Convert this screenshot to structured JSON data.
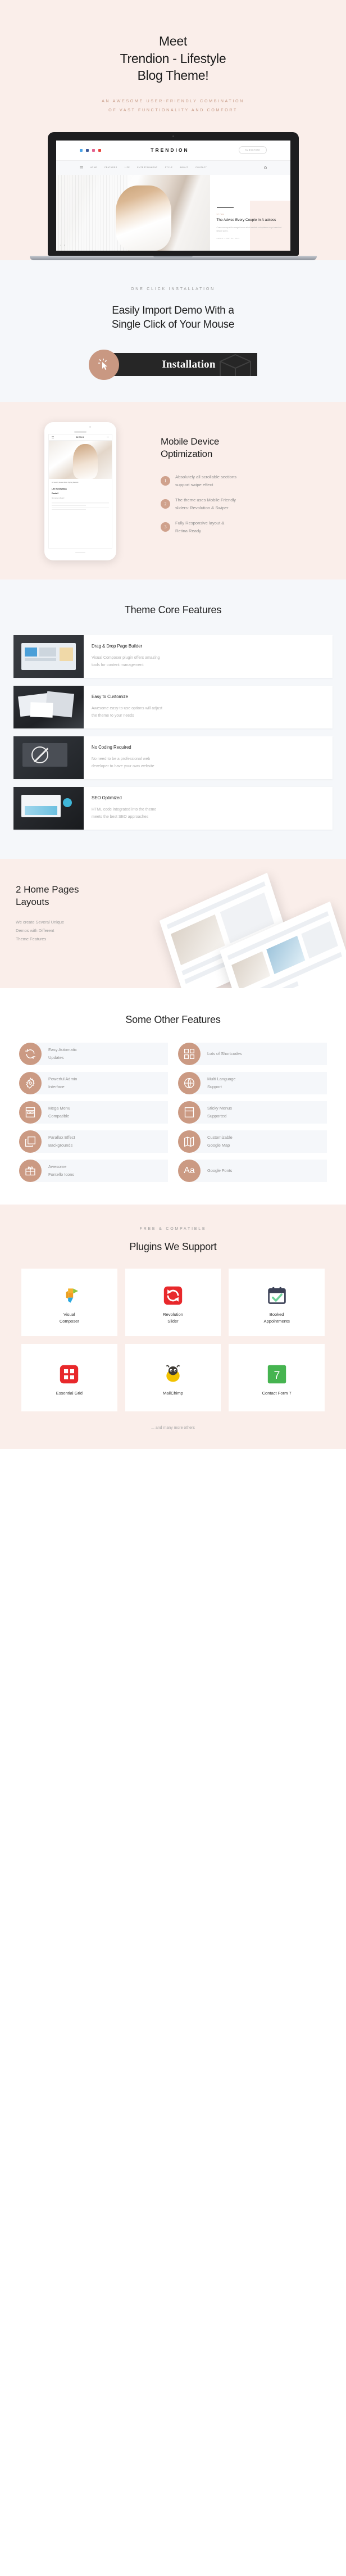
{
  "hero": {
    "title_line1": "Meet",
    "title_line2": "Trendion - Lifestyle",
    "title_line3": "Blog Theme!",
    "subtitle_line1": "AN AWESOME USER-FRIENDLY COMBINATION",
    "subtitle_line2": "OF VAST FUNCTIONALITY AND COMFORT",
    "mockup": {
      "logo": "TRENDION",
      "subscribe_button": "SUBSCRIBE",
      "nav": [
        "HOME",
        "FEATURES",
        "LIFE",
        "ENTERTAINMENT",
        "STYLE",
        "ABOUT",
        "CONTACT"
      ],
      "post_category": "STYLE",
      "post_title": "The Advice Every Couple In A ackess",
      "post_excerpt": "Cras consequat fur magni lorem sit sit rahtinis voluptatem sequi nesciunt. Neque porro.",
      "post_meta": "ADMIN   —   MAY 22, 2019"
    }
  },
  "install": {
    "eyebrow": "ONE CLICK INSTALLATION",
    "title_line1": "Easily Import Demo With a",
    "title_line2": "Single Click of Your Mouse",
    "badge_label": "Installation"
  },
  "mobile": {
    "title_line1": "Mobile Device",
    "title_line2": "Optimization",
    "items": [
      {
        "num": "1",
        "text_line1": "Absolutely all scrollable sections",
        "text_line2": "support swipe effect"
      },
      {
        "num": "2",
        "text_line1": "The theme uses Mobile Friendly",
        "text_line2": "sliders: Revolution & Swiper"
      },
      {
        "num": "3",
        "text_line1": "Fully Responsive layout &",
        "text_line2": "Retina Ready"
      }
    ],
    "phone": {
      "menu_label": "MENU",
      "logo": "TRENDION",
      "caption": "All Luxury House Floor Spring Defects",
      "post_title_line1": "Life Events Blog",
      "post_title_line2": "Posts 2",
      "post_sub": "My name is Ryan!"
    }
  },
  "core": {
    "title": "Theme Core Features",
    "cards": [
      {
        "title": "Drag & Drop Page Builder",
        "desc_line1": "Visual Composer plugin offers amazing",
        "desc_line2": "tools for content management"
      },
      {
        "title": "Easy to Customize",
        "desc_line1": "Awesome easy-to-use options will adjust",
        "desc_line2": "the theme to your needs"
      },
      {
        "title": "No Coding Required",
        "desc_line1": "No need to be a professional web",
        "desc_line2": "developer to have your own website"
      },
      {
        "title": "SEO Optimized",
        "desc_line1": "HTML code integrated into the theme",
        "desc_line2": "meets the best SEO approaches"
      }
    ]
  },
  "homes": {
    "title_line1": "2 Home Pages",
    "title_line2": "Layouts",
    "desc_line1": "We create Several Unique",
    "desc_line2": "Demos with Different",
    "desc_line3": "Theme Features"
  },
  "other": {
    "title": "Some Other Features",
    "items": [
      {
        "icon": "refresh-icon",
        "label_line1": "Easy Automatic",
        "label_line2": "Updates"
      },
      {
        "icon": "shortcodes-grid-icon",
        "label_line1": "Lots of Shortcodes",
        "label_line2": ""
      },
      {
        "icon": "gear-icon",
        "label_line1": "Powerful Admin",
        "label_line2": "Interface"
      },
      {
        "icon": "globe-icon",
        "label_line1": "Multi Language",
        "label_line2": "Support"
      },
      {
        "icon": "mega-menu-icon",
        "label_line1": "Mega Menu",
        "label_line2": "Compatible"
      },
      {
        "icon": "sticky-menu-icon",
        "label_line1": "Sticky Menus",
        "label_line2": "Supported"
      },
      {
        "icon": "layers-icon",
        "label_line1": "Parallax Effect",
        "label_line2": "Backgrounds"
      },
      {
        "icon": "map-icon",
        "label_line1": "Customizable",
        "label_line2": "Google Map"
      },
      {
        "icon": "gift-icon",
        "label_line1": "Awesome",
        "label_line2": "Fontello Icons"
      },
      {
        "icon": "typography-icon",
        "label_line1": "Google Fonts",
        "label_line2": ""
      }
    ]
  },
  "plugins": {
    "eyebrow": "FREE & COMPATIBLE",
    "title": "Plugins We Support",
    "items": [
      {
        "icon": "visual-composer-logo",
        "name_line1": "Visual",
        "name_line2": "Composer"
      },
      {
        "icon": "revolution-slider-logo",
        "name_line1": "Revolution",
        "name_line2": "Slider"
      },
      {
        "icon": "booked-appointments-logo",
        "name_line1": "Booked",
        "name_line2": "Appointments"
      },
      {
        "icon": "essential-grid-logo",
        "name_line1": "Essential Grid",
        "name_line2": ""
      },
      {
        "icon": "mailchimp-logo",
        "name_line1": "MailChimp",
        "name_line2": ""
      },
      {
        "icon": "contact-form-7-logo",
        "name_line1": "Contact Form 7",
        "name_line2": ""
      }
    ],
    "more_text": "... and many more others"
  },
  "colors": {
    "accent": "#cb9a83",
    "pink_bg": "#faeeea",
    "gray_bg": "#f5f7fa",
    "dark": "#262626"
  }
}
